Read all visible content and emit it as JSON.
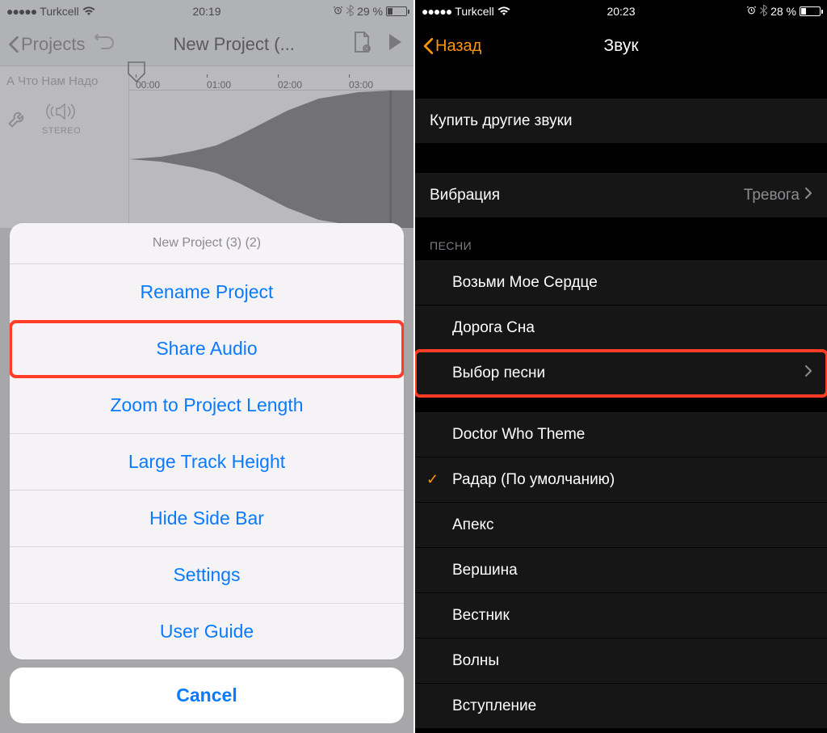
{
  "left": {
    "status": {
      "carrier": "Turkcell",
      "time": "20:19",
      "battery": "29 %"
    },
    "header": {
      "back_label": "Projects",
      "title": "New Project (..."
    },
    "sidebar": {
      "track_name": "А Что Нам Надо",
      "mode": "STEREO"
    },
    "ruler": [
      "00:00",
      "01:00",
      "02:00",
      "03:00"
    ],
    "sheet": {
      "title": "New Project (3) (2)",
      "items": [
        "Rename Project",
        "Share Audio",
        "Zoom to Project Length",
        "Large Track Height",
        "Hide Side Bar",
        "Settings",
        "User Guide"
      ],
      "highlight_index": 1,
      "cancel": "Cancel"
    }
  },
  "right": {
    "status": {
      "carrier": "Turkcell",
      "time": "20:23",
      "battery": "28 %"
    },
    "header": {
      "back_label": "Назад",
      "title": "Звук"
    },
    "rows": {
      "buy": "Купить другие звуки",
      "vibration_label": "Вибрация",
      "vibration_value": "Тревога",
      "songs_header": "ПЕСНИ",
      "songs": [
        "Возьми Мое Сердце",
        "Дорога Сна",
        "Выбор песни"
      ],
      "highlight_song_index": 2,
      "ringtones": [
        {
          "label": "Doctor Who Theme",
          "checked": false
        },
        {
          "label": "Радар (По умолчанию)",
          "checked": true
        },
        {
          "label": "Апекс",
          "checked": false
        },
        {
          "label": "Вершина",
          "checked": false
        },
        {
          "label": "Вестник",
          "checked": false
        },
        {
          "label": "Волны",
          "checked": false
        },
        {
          "label": "Вступление",
          "checked": false
        }
      ]
    }
  }
}
